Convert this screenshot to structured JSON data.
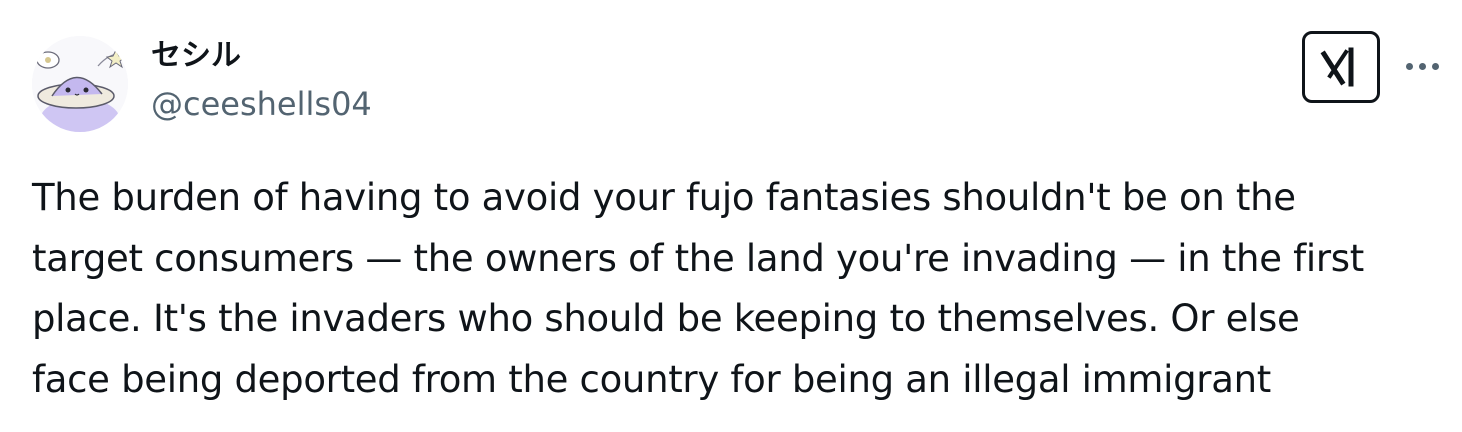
{
  "author": {
    "display_name": "セシル",
    "handle": "@ceeshells04"
  },
  "actions": {
    "grok_icon": "grok-icon",
    "more_icon": "more-icon"
  },
  "tweet": {
    "lines": [
      "The burden of having to avoid your fujo fantasies shouldn't be on the",
      "target consumers — the owners of the land you're invading — in the first",
      "place. It's the invaders who should be keeping to themselves. Or else",
      "face being deported from the country for being an illegal immigrant"
    ]
  },
  "colors": {
    "text": "#0f1419",
    "secondary": "#536471",
    "avatar_accent": "#c9bdf0"
  }
}
